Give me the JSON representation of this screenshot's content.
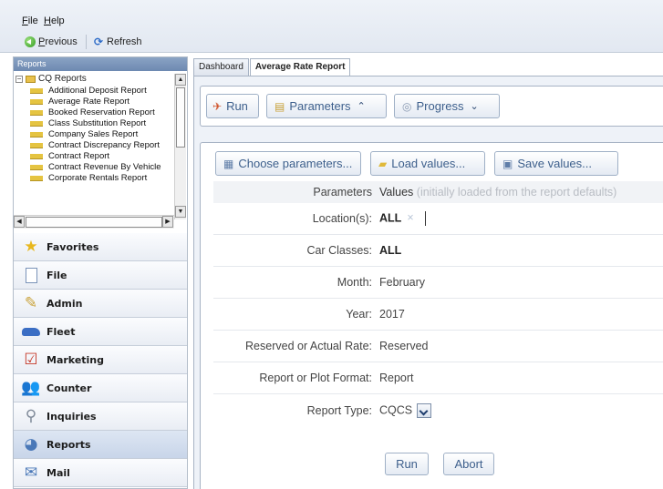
{
  "menu": {
    "file": "File",
    "help": "Help"
  },
  "toolbar": {
    "previous": "Previous",
    "refresh": "Refresh"
  },
  "left": {
    "reports_header": "Reports",
    "tree_root": "CQ Reports",
    "tree_items": [
      "Additional Deposit Report",
      "Average Rate Report",
      "Booked Reservation Report",
      "Class Substitution Report",
      "Company Sales Report",
      "Contract Discrepancy Report",
      "Contract Report",
      "Contract Revenue By Vehicle",
      "Corporate Rentals Report"
    ],
    "nav": [
      {
        "label": "Favorites",
        "icon": "star-icon"
      },
      {
        "label": "File",
        "icon": "document-icon"
      },
      {
        "label": "Admin",
        "icon": "admin-icon"
      },
      {
        "label": "Fleet",
        "icon": "car-icon"
      },
      {
        "label": "Marketing",
        "icon": "marketing-icon"
      },
      {
        "label": "Counter",
        "icon": "users-icon"
      },
      {
        "label": "Inquiries",
        "icon": "magnifier-icon"
      },
      {
        "label": "Reports",
        "icon": "reports-icon"
      },
      {
        "label": "Mail",
        "icon": "mail-icon"
      }
    ]
  },
  "tabs": {
    "dashboard": "Dashboard",
    "average_rate": "Average Rate Report"
  },
  "actions": {
    "run": "Run",
    "parameters": "Parameters",
    "progress": "Progress"
  },
  "param_buttons": {
    "choose": "Choose parameters...",
    "load": "Load values...",
    "save": "Save values..."
  },
  "params": {
    "header_label": "Parameters",
    "header_values": "Values",
    "header_hint": "(initially loaded from the report defaults)",
    "rows": [
      {
        "label": "Location(s):",
        "value": "ALL"
      },
      {
        "label": "Car Classes:",
        "value": "ALL"
      },
      {
        "label": "Month:",
        "value": "February"
      },
      {
        "label": "Year:",
        "value": "2017"
      },
      {
        "label": "Reserved or Actual Rate:",
        "value": "Reserved"
      },
      {
        "label": "Report or Plot Format:",
        "value": "Report"
      },
      {
        "label": "Report Type:",
        "value": "CQCS"
      }
    ]
  },
  "bottom": {
    "run": "Run",
    "abort": "Abort"
  },
  "colors": {
    "accent": "#3d5f8c",
    "active_nav": "#c8d5e9",
    "border": "#a7b3c4"
  }
}
